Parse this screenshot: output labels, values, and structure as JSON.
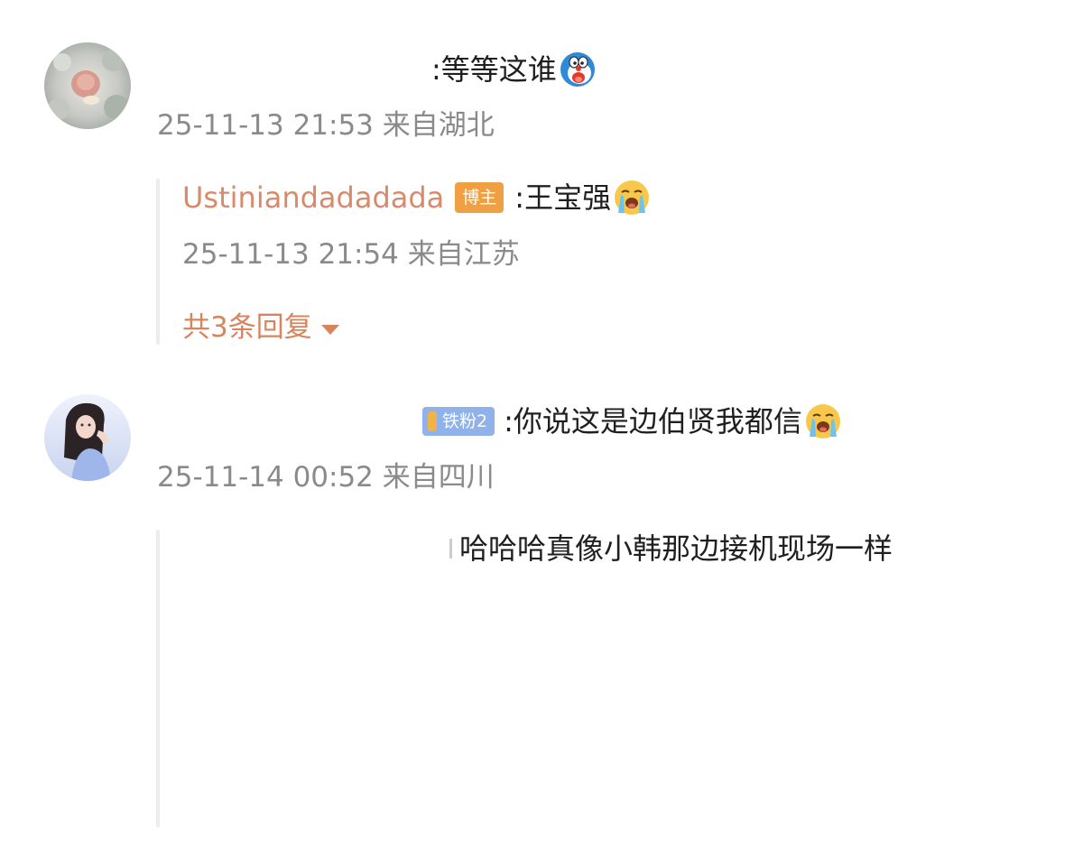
{
  "comments": [
    {
      "avatar_icon": "flower-avatar-icon",
      "text": ":等等这谁",
      "emoji": "doraemon-emoji-icon",
      "time": "25-11-13 21:53",
      "location": "来自湖北",
      "reply": {
        "username": "Ustiniandadadada",
        "badge": "博主",
        "text": ":王宝强",
        "emoji": "crying-emoji-icon",
        "time": "25-11-13 21:54",
        "location": "来自江苏"
      },
      "reply_count_label": "共3条回复"
    },
    {
      "avatar_icon": "girl-portrait-avatar-icon",
      "badge": "铁粉2",
      "text": ":你说这是边伯贤我都信",
      "emoji": "crying-emoji-icon",
      "time": "25-11-14 00:52",
      "location": "来自四川",
      "reply": {
        "text": "哈哈哈真像小韩那边接机现场一样"
      }
    }
  ],
  "colors": {
    "reply_username": "#d98a6b",
    "reply_count": "#d8855d",
    "meta_gray": "#8a8a8a",
    "badge_bozhu": "#f0a042",
    "badge_tiefen": "#8fb2ea"
  }
}
